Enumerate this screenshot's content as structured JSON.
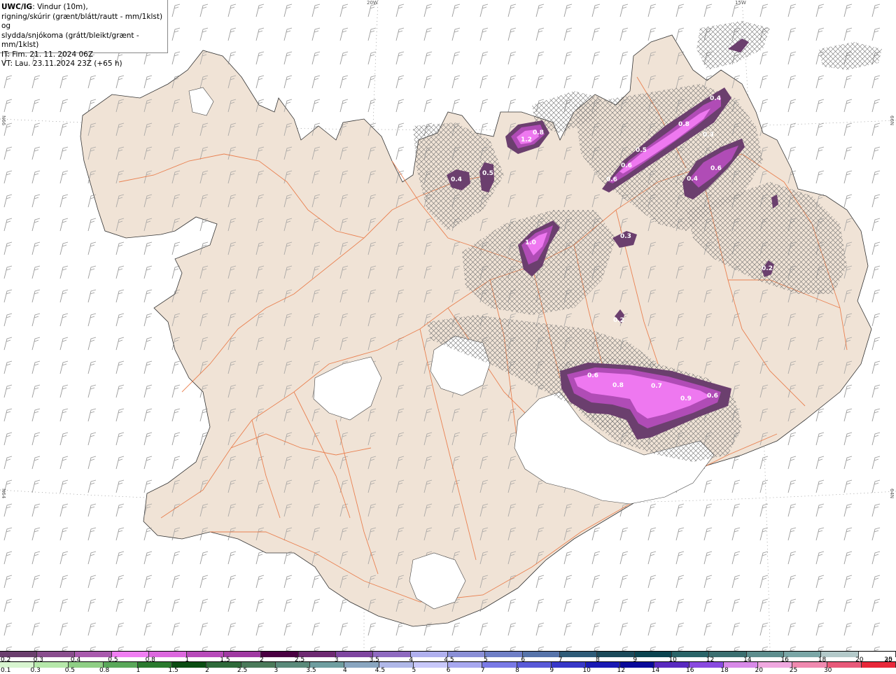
{
  "header": {
    "model": "UWC/IG",
    "desc_line1": ": Vindur (10m),",
    "desc_line2": "rigning/skúrir (grænt/blátt/rautt - mm/1klst) og",
    "desc_line3": "slydda/snjókoma (grátt/bleikt/grænt - mm/1klst)",
    "init_time": "IT: Fim. 21. 11. 2024 06Z",
    "valid_time": "VT: Lau. 23.11.2024 23Z (+65 h)"
  },
  "grid_labels": {
    "lon_20w": "20W",
    "lon_15w": "15W",
    "lat_66n_left": "N66",
    "lat_66n_right": "66N",
    "lat_64n_left": "N64",
    "lat_64n_right": "64N"
  },
  "precip_labels": [
    {
      "text": "0.4"
    },
    {
      "text": "0.8"
    },
    {
      "text": "0.3"
    },
    {
      "text": "0.5"
    },
    {
      "text": "0.6"
    },
    {
      "text": "0.6"
    },
    {
      "text": "0.6"
    },
    {
      "text": "0.4"
    },
    {
      "text": "0.8"
    },
    {
      "text": "1.2"
    },
    {
      "text": "0.4"
    },
    {
      "text": "0.5"
    },
    {
      "text": "1.0"
    },
    {
      "text": "0.3"
    },
    {
      "text": "0.2"
    },
    {
      "text": "0.2"
    },
    {
      "text": "0.6"
    },
    {
      "text": "0.8"
    },
    {
      "text": "0.7"
    },
    {
      "text": "0.9"
    },
    {
      "text": "0.6"
    }
  ],
  "legend_snow": {
    "colors": [
      "#6b3f6e",
      "#8a4e8e",
      "#a95aad",
      "#f07ef2",
      "#dc68de",
      "#b84bba",
      "#a03aa2",
      "#4a0042",
      "#6e2a72",
      "#7f46a0",
      "#8f6ac0",
      "#b0b0ee",
      "#8a8fd6",
      "#6f7fc6",
      "#5774aa",
      "#2f5c78",
      "#1b4a5a",
      "#0b4450",
      "#2a6468",
      "#3b6f70",
      "#5e8e8e",
      "#7aa6a6",
      "#b3c9c9",
      "#ffffff"
    ],
    "labels": [
      "0.2",
      "0.3",
      "0.4",
      "0.5",
      "0.8",
      "1",
      "1.5",
      "2",
      "2.5",
      "3",
      "3.5",
      "4",
      "4.5",
      "5",
      "6",
      "7",
      "8",
      "9",
      "10",
      "12",
      "14",
      "16",
      "18",
      "20",
      "25",
      "30"
    ]
  },
  "legend_rain": {
    "colors": [
      "#d8f5d0",
      "#b6e8aa",
      "#8fcf85",
      "#5aa85a",
      "#2a7a2e",
      "#0a4d12",
      "#2e6a3a",
      "#4b7a5a",
      "#5a8a7a",
      "#6f9ea0",
      "#8aa6c0",
      "#b0b8e8",
      "#c8c8fa",
      "#a8a8f0",
      "#7a7ae6",
      "#5a5ad8",
      "#3838c8",
      "#1a1ab4",
      "#0a0a9a",
      "#5a2ac0",
      "#8a4ae0",
      "#d88ae8",
      "#f0a8e0",
      "#f08ab0",
      "#e85a7a",
      "#e8283a"
    ],
    "labels": [
      "0.1",
      "0.3",
      "0.5",
      "0.8",
      "1",
      "1.5",
      "2",
      "2.5",
      "3",
      "3.5",
      "4",
      "4.5",
      "5",
      "6",
      "7",
      "8",
      "9",
      "10",
      "12",
      "14",
      "16",
      "18",
      "20",
      "25",
      "30"
    ]
  },
  "colors": {
    "land": "#f0e3d6",
    "sea": "#ffffff",
    "roads": "#e8703a",
    "glacier": "#ffffff",
    "hatch": "#777777",
    "precip_light": "#6b3f6e",
    "precip_mid": "#b04cb6",
    "precip_high": "#ee78f0"
  }
}
